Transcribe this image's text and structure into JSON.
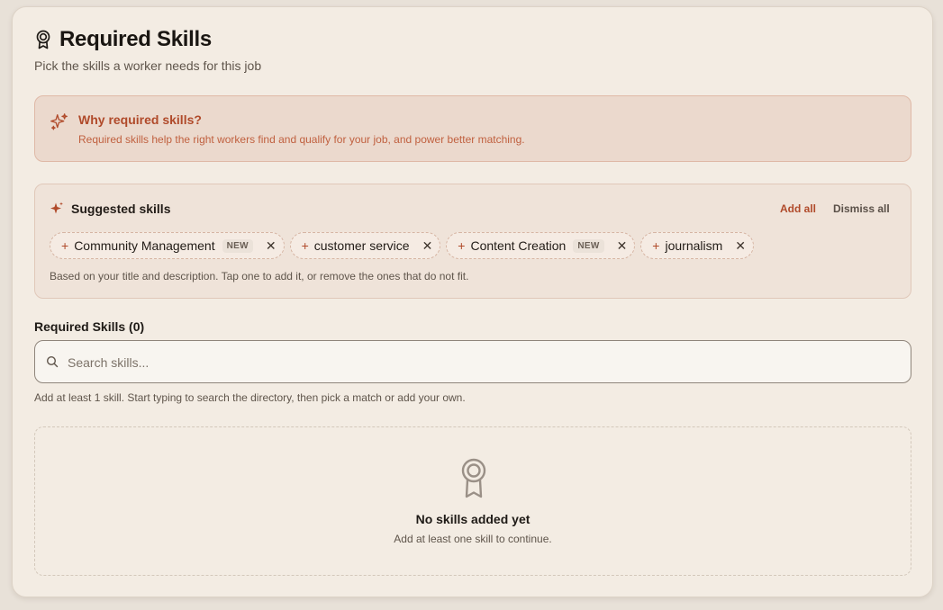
{
  "header": {
    "title": "Required Skills",
    "subtitle": "Pick the skills a worker needs for this job",
    "icon": "award-icon"
  },
  "why_box": {
    "title": "Why required skills?",
    "text": "Required skills help the right workers find and qualify for your job, and power better matching.",
    "icon": "sparkles-icon",
    "accent": "#b04a2a"
  },
  "suggested": {
    "title": "Suggested skills",
    "add_all_label": "Add all",
    "dismiss_all_label": "Dismiss all",
    "chips": [
      {
        "label": "Community Management",
        "badge": "NEW"
      },
      {
        "label": "customer service",
        "badge": ""
      },
      {
        "label": "Content Creation",
        "badge": "NEW"
      },
      {
        "label": "journalism",
        "badge": ""
      }
    ],
    "note": "Based on your title and description. Tap one to add it, or remove the ones that do not fit."
  },
  "required": {
    "label": "Required Skills (0)",
    "search_placeholder": "Search skills...",
    "search_value": "",
    "help": "Add at least 1 skill. Start typing to search the directory, then pick a match or add your own."
  },
  "empty_state": {
    "title": "No skills added yet",
    "subtitle": "Add at least one skill to continue.",
    "icon": "award-icon"
  }
}
